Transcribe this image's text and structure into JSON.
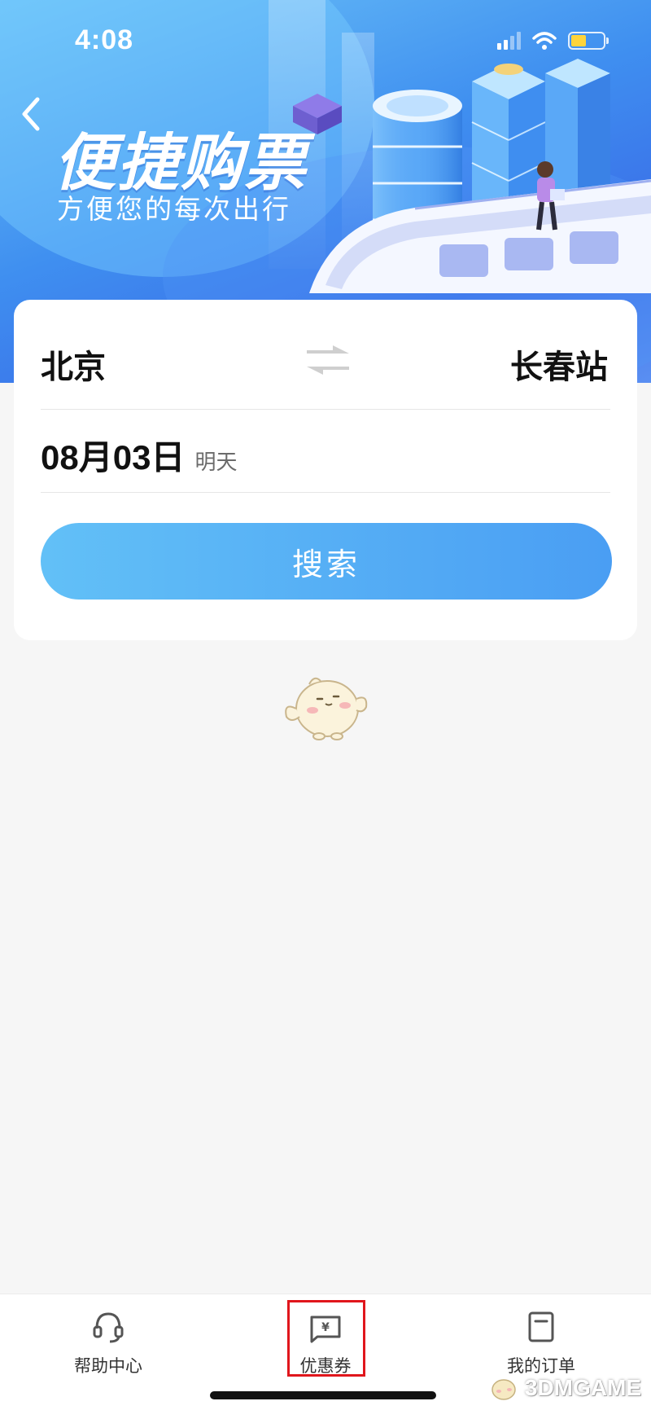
{
  "status_bar": {
    "time": "4:08"
  },
  "banner": {
    "title": "便捷购票",
    "subtitle": "方便您的每次出行"
  },
  "search_card": {
    "from_station": "北京",
    "to_station": "长春站",
    "date": "08月03日",
    "date_hint": "明天",
    "search_label": "搜索"
  },
  "tabbar": {
    "items": [
      {
        "label": "帮助中心",
        "icon": "headset-icon"
      },
      {
        "label": "优惠券",
        "icon": "coupon-icon"
      },
      {
        "label": "我的订单",
        "icon": "order-icon"
      }
    ]
  },
  "watermark": {
    "text": "3DMGAME"
  },
  "colors": {
    "accent": "#4a9ef3",
    "highlight_box": "#e0161c",
    "battery": "#ffd43a"
  }
}
